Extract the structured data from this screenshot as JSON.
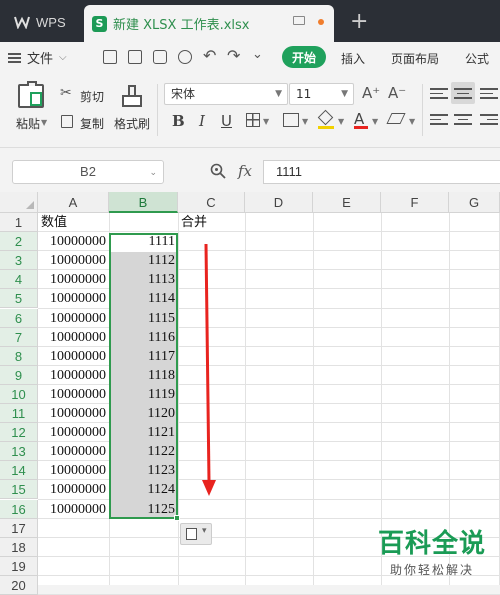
{
  "titlebar": {
    "app_label": "WPS",
    "file_name": "新建 XLSX 工作表.xlsx",
    "new_tab": "+"
  },
  "menubar": {
    "file_label": "文件",
    "start_label": "开始",
    "insert_label": "插入",
    "page_layout_label": "页面布局",
    "formula_label": "公式"
  },
  "ribbon": {
    "paste_label": "粘贴",
    "cut_label": "剪切",
    "copy_label": "复制",
    "format_painter_label": "格式刷",
    "font_name": "宋体",
    "font_size": "11",
    "bold": "B",
    "italic": "I",
    "underline": "U",
    "grow_font": "A⁺",
    "shrink_font": "A⁻",
    "font_color": "A"
  },
  "formula_bar": {
    "cell_ref": "B2",
    "fx": "fx",
    "content": "1111"
  },
  "sheet": {
    "columns": [
      "A",
      "B",
      "C",
      "D",
      "E",
      "F",
      "G"
    ],
    "rows": [
      "1",
      "2",
      "3",
      "4",
      "5",
      "6",
      "7",
      "8",
      "9",
      "10",
      "11",
      "12",
      "13",
      "14",
      "15",
      "16",
      "17",
      "18",
      "19",
      "20"
    ],
    "header_a": "数值",
    "header_c": "合并",
    "col_a_values": [
      "10000000",
      "10000000",
      "10000000",
      "10000000",
      "10000000",
      "10000000",
      "10000000",
      "10000000",
      "10000000",
      "10000000",
      "10000000",
      "10000000",
      "10000000",
      "10000000",
      "10000000"
    ],
    "col_b_values": [
      "1111",
      "1112",
      "1113",
      "1114",
      "1115",
      "1116",
      "1117",
      "1118",
      "1119",
      "1120",
      "1121",
      "1122",
      "1123",
      "1124",
      "1125"
    ]
  },
  "colors": {
    "accent": "#1fa15c",
    "selection_border": "#2f9a4e",
    "arrow": "#e8231f",
    "titlebar": "#2b2f36"
  },
  "watermark": {
    "main": "百科全说",
    "sub": "助你轻松解决"
  }
}
